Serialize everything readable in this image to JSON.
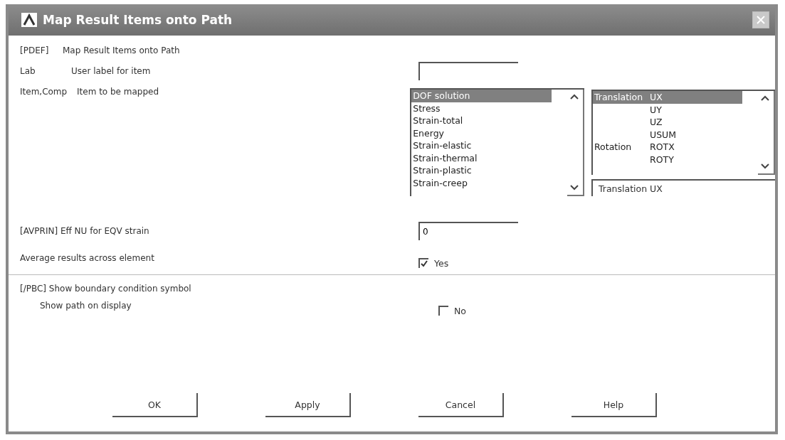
{
  "window": {
    "title": "Map Result Items onto Path"
  },
  "heading": {
    "code": "[PDEF]",
    "text": "Map Result Items onto Path"
  },
  "lab": {
    "code": "Lab",
    "label": "User label for item"
  },
  "item_comp": {
    "code": "Item,Comp",
    "label": "Item to be mapped",
    "items": [
      {
        "text": "DOF solution",
        "selected": true
      },
      {
        "text": "Stress",
        "selected": false
      },
      {
        "text": "Strain-total",
        "selected": false
      },
      {
        "text": "Energy",
        "selected": false
      },
      {
        "text": "Strain-elastic",
        "selected": false
      },
      {
        "text": "Strain-thermal",
        "selected": false
      },
      {
        "text": "Strain-plastic",
        "selected": false
      },
      {
        "text": "Strain-creep",
        "selected": false
      }
    ],
    "components": [
      {
        "group": "Translation",
        "comp": "UX",
        "selected": true
      },
      {
        "comp": "UY",
        "selected": false
      },
      {
        "comp": "UZ",
        "selected": false
      },
      {
        "comp": "USUM",
        "selected": false
      },
      {
        "group": "Rotation",
        "comp": "ROTX",
        "selected": false
      },
      {
        "comp": "ROTY",
        "selected": false
      }
    ],
    "component_value": "Translation  UX"
  },
  "avprin": {
    "label": "[AVPRIN] Eff NU for EQV strain",
    "value": "0"
  },
  "average": {
    "label": "Average results across element",
    "option": "Yes",
    "checked": true
  },
  "pbc": {
    "heading": "[/PBC] Show boundary condition symbol",
    "label": "Show path on display",
    "option": "No",
    "checked": false
  },
  "buttons": [
    "OK",
    "Apply",
    "Cancel",
    "Help"
  ]
}
